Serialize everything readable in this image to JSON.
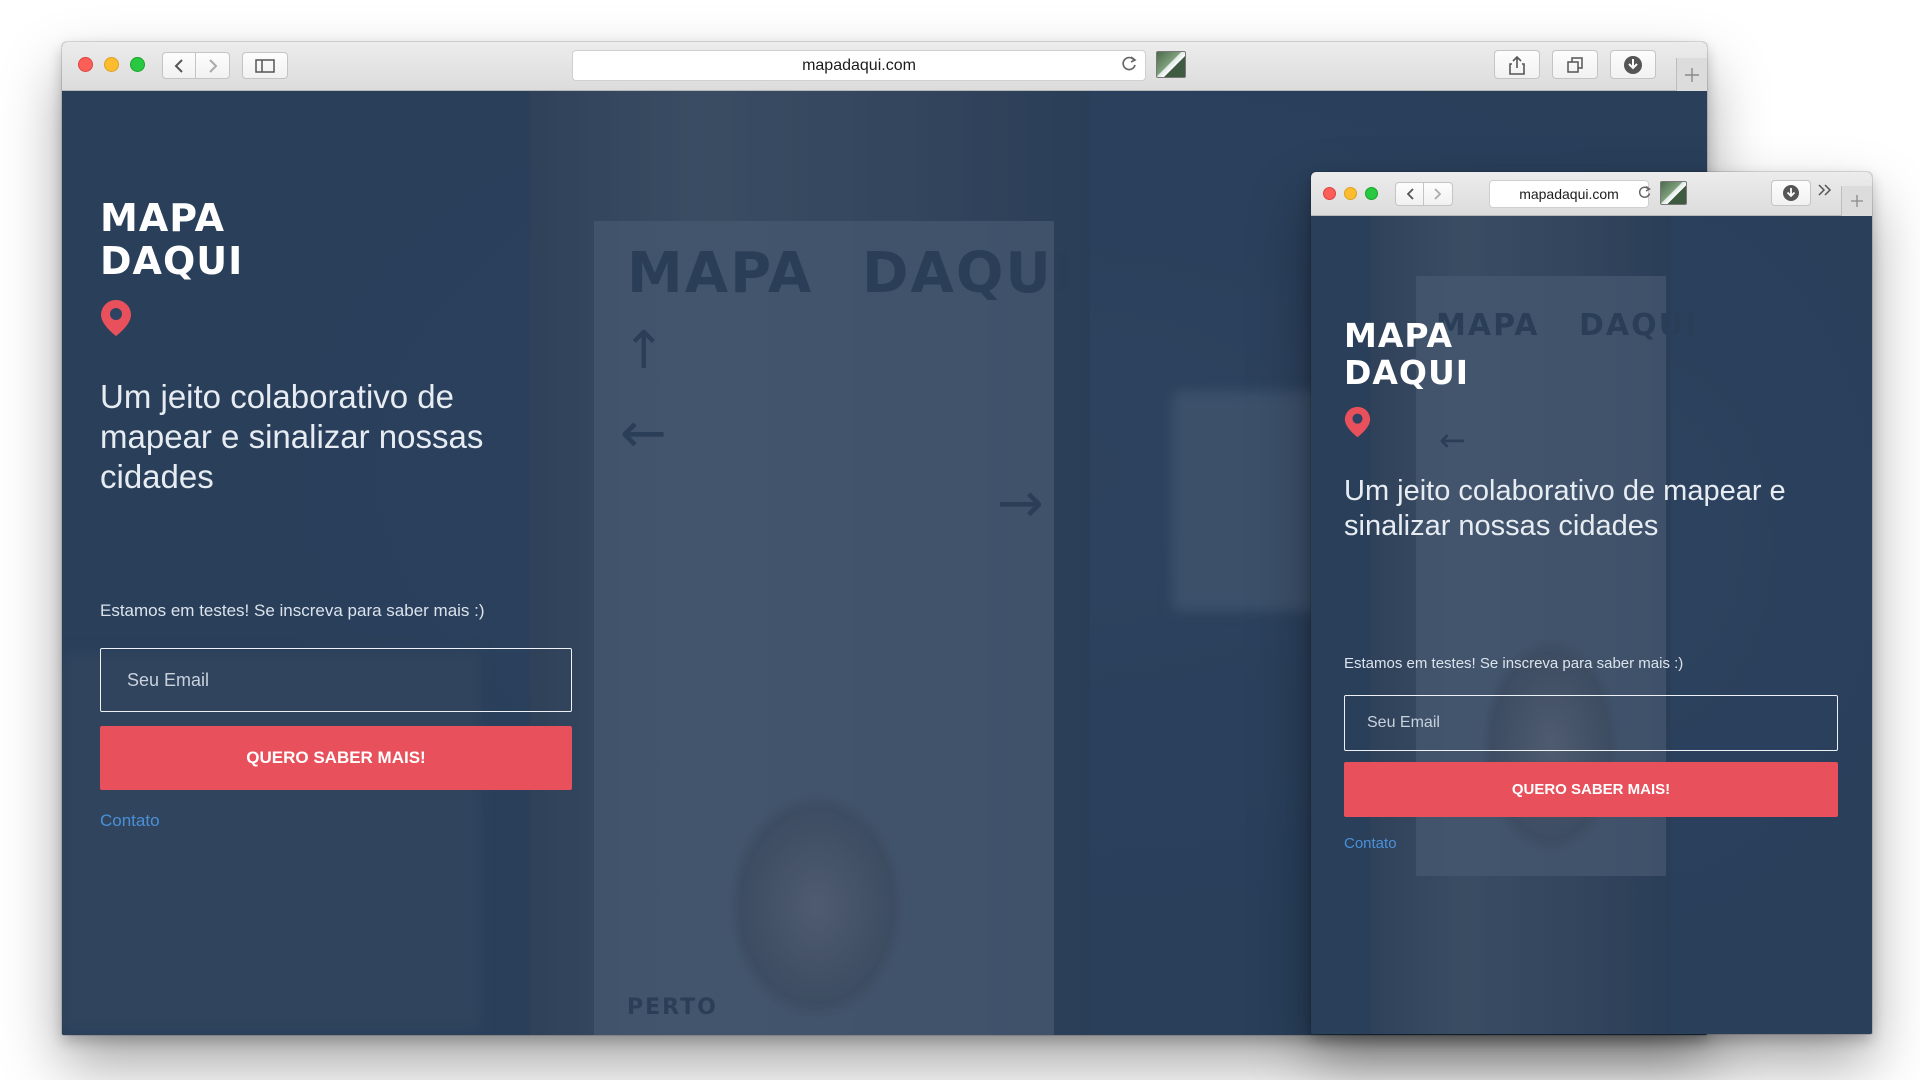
{
  "desktop": {
    "url": "mapadaqui.com",
    "page": {
      "logo_line1": "MAPA",
      "logo_line2": "DAQUI",
      "headline_line1": "Um jeito colaborativo de",
      "headline_line2": "mapear e sinalizar nossas",
      "headline_line3": "cidades",
      "subtext": "Estamos em testes! Se inscreva para saber mais :)",
      "email_placeholder": "Seu Email",
      "cta_label": "QUERO SABER MAIS!",
      "contact_label": "Contato"
    },
    "background_poster": {
      "title_left": "MAPA",
      "title_right": "DAQUI",
      "footer": "PERTO"
    }
  },
  "tablet": {
    "url": "mapadaqui.com",
    "page": {
      "logo_line1": "MAPA",
      "logo_line2": "DAQUI",
      "headline_line1": "Um jeito colaborativo de mapear e",
      "headline_line2": "sinalizar nossas cidades",
      "subtext": "Estamos em testes! Se inscreva para saber mais :)",
      "email_placeholder": "Seu Email",
      "cta_label": "QUERO SABER MAIS!",
      "contact_label": "Contato"
    },
    "background_poster": {
      "title_left": "MAPA",
      "title_right": "DAQUI"
    }
  },
  "colors": {
    "accent": "#e8505b",
    "link": "#4a90d9",
    "overlay": "#2e4362",
    "pin": "#e8505b"
  },
  "icons": {
    "back": "chevron-left-icon",
    "forward": "chevron-right-icon",
    "sidebar": "sidebar-icon",
    "reload": "reload-icon",
    "share": "share-icon",
    "tabs": "tabs-icon",
    "downloads": "download-icon",
    "new_tab": "plus-icon",
    "overflow": "double-chevron-icon",
    "location": "map-pin-icon"
  }
}
